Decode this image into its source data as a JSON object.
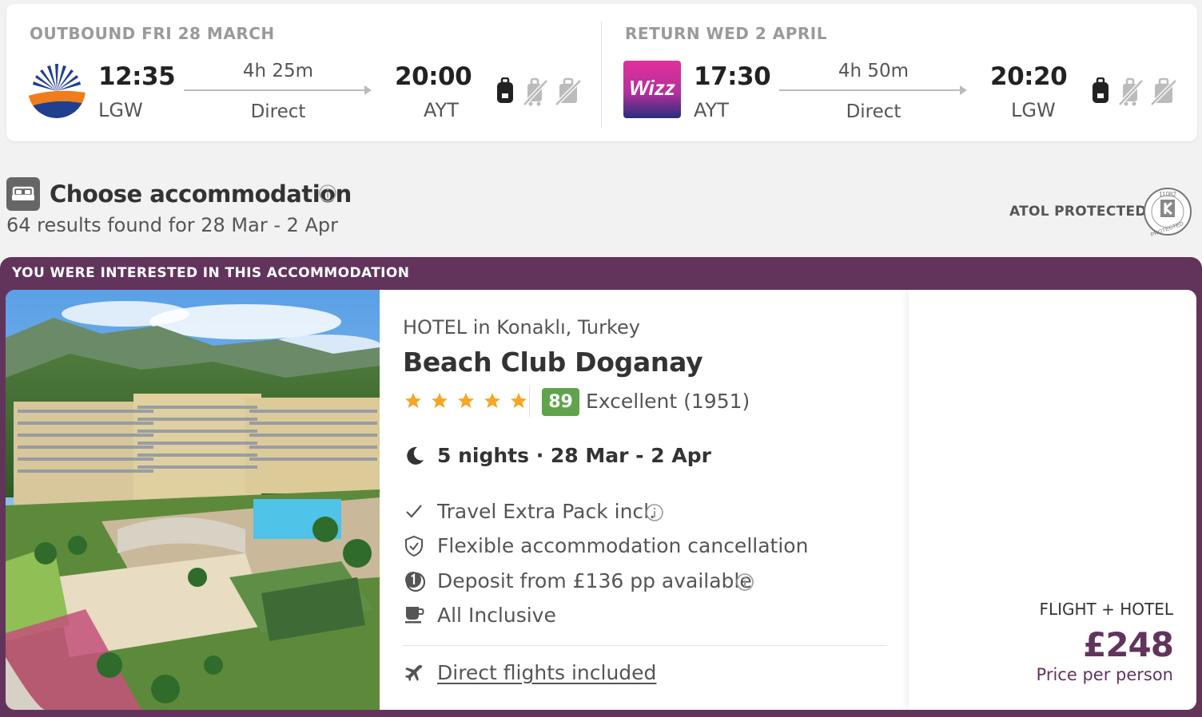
{
  "outbound": {
    "title": "OUTBOUND FRI 28 MARCH",
    "airline_logo": "sunexpress-logo",
    "depart_time": "12:35",
    "depart_code": "LGW",
    "duration": "4h 25m",
    "stops": "Direct",
    "arrive_time": "20:00",
    "arrive_code": "AYT",
    "baggage_icons": [
      "cabin-bag-included-icon",
      "checked-bag-excluded-icon",
      "hold-luggage-excluded-icon"
    ]
  },
  "return": {
    "title": "RETURN WED 2 APRIL",
    "airline_logo": "wizz-logo",
    "airline_logo_text": "Wizz",
    "depart_time": "17:30",
    "depart_code": "AYT",
    "duration": "4h 50m",
    "stops": "Direct",
    "arrive_time": "20:20",
    "arrive_code": "LGW",
    "baggage_icons": [
      "cabin-bag-included-icon",
      "checked-bag-excluded-icon",
      "hold-luggage-excluded-icon"
    ]
  },
  "accommodation_section": {
    "title": "Choose accommodation",
    "results": "64 results found for 28 Mar - 2 Apr",
    "atol_label": "ATOL PROTECTED",
    "atol_number": "11082",
    "atol_ring_text": "PROTECTED"
  },
  "hotel": {
    "banner": "YOU WERE INTERESTED IN THIS ACCOMMODATION",
    "type_location": "HOTEL in Konaklı, Turkey",
    "name": "Beach Club Doganay",
    "stars": 5,
    "score": "89",
    "score_text": "Excellent (1951)",
    "nights": "5 nights · 28 Mar - 2 Apr",
    "features": [
      {
        "label": "Travel Extra Pack incl.",
        "icon": "check-icon"
      },
      {
        "label": "Flexible accommodation cancellation",
        "icon": "shield-check-icon"
      },
      {
        "label": "Deposit from £136 pp available",
        "icon": "deposit-icon"
      },
      {
        "label": "All Inclusive",
        "icon": "cup-icon"
      }
    ],
    "flights_link": "Direct flights included",
    "price_label": "FLIGHT + HOTEL",
    "price": "£248",
    "price_sub": "Price per person"
  },
  "colors": {
    "brand_purple": "#62345c",
    "score_green": "#5fa34a",
    "star_orange": "#f5a623"
  }
}
